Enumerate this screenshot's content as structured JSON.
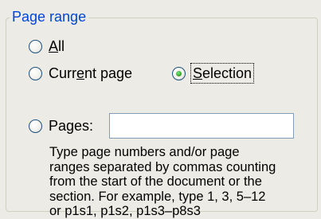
{
  "group": {
    "title": "Page range"
  },
  "options": {
    "all": {
      "label_pre": "",
      "label_u": "A",
      "label_post": "ll",
      "checked": false
    },
    "current": {
      "label_pre": "Curr",
      "label_u": "e",
      "label_post": "nt page",
      "checked": false
    },
    "selection": {
      "label_pre": "",
      "label_u": "S",
      "label_post": "election",
      "checked": true
    },
    "pages": {
      "label_pre": "Pa",
      "label_u": "g",
      "label_post": "es:",
      "checked": false
    }
  },
  "pages_input": {
    "value": ""
  },
  "help": {
    "text": "Type page numbers and/or page\nranges separated by commas counting\nfrom the start of the document or the\nsection. For example, type 1, 3, 5–12\nor p1s1, p1s2, p1s3–p8s3"
  },
  "colors": {
    "legend": "#0046d5",
    "background": "#ecebe5",
    "radio_dot": "#2fa11f"
  }
}
